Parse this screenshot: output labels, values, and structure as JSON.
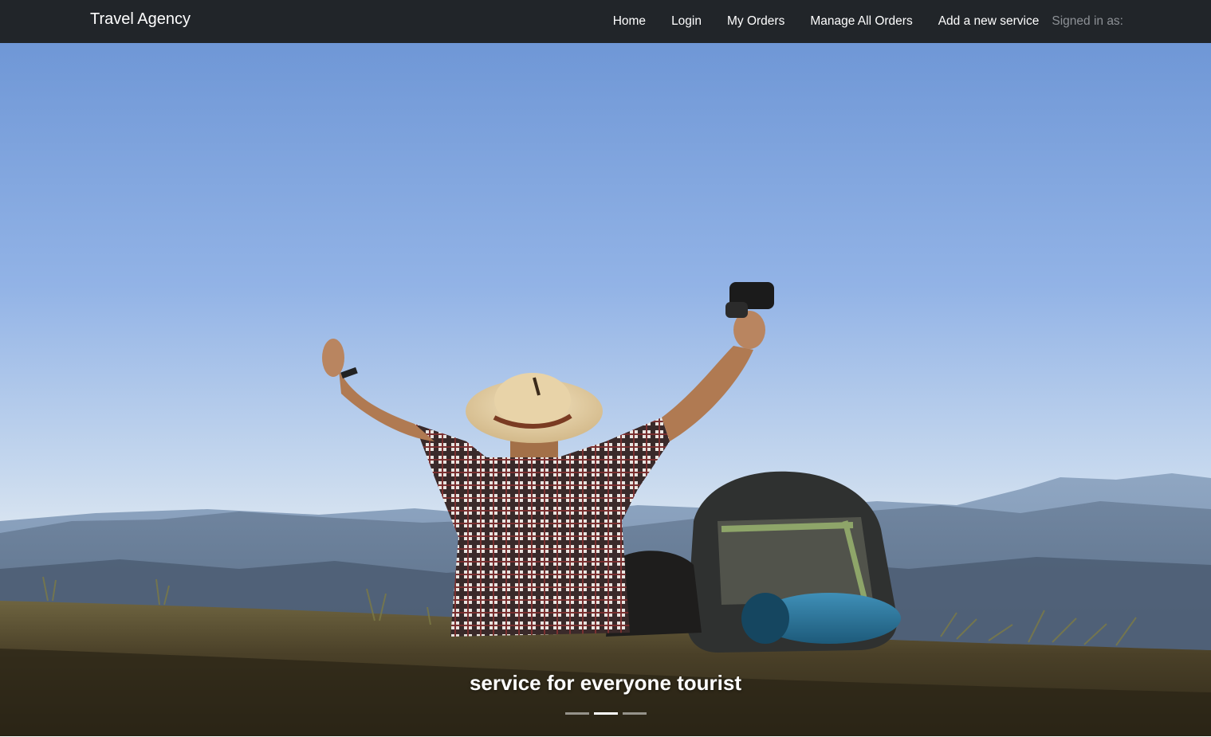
{
  "navbar": {
    "brand": "Travel Agency",
    "links": [
      "Home",
      "Login",
      "My Orders",
      "Manage All Orders",
      "Add a new service"
    ],
    "signed_in_label": "Signed in as:"
  },
  "carousel": {
    "caption": "service for everyone tourist",
    "slide_count": 3,
    "active_index": 1
  },
  "colors": {
    "navbar_bg": "#212529",
    "nav_text": "#ffffff",
    "muted_text": "#8d9196"
  }
}
